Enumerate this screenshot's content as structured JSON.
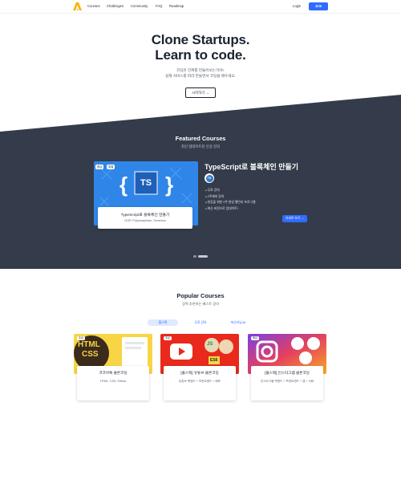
{
  "nav": {
    "links": [
      "Courses",
      "Challenges",
      "Community",
      "FAQ",
      "Roadmap"
    ],
    "login": "Login",
    "join": "Join"
  },
  "hero": {
    "title_line1": "Clone Startups.",
    "title_line2": "Learn to code.",
    "sub_line1": "코딩은 진짜를 만들어보는거야!.",
    "sub_line2": "실제 서비스를 따라 만들면서 코딩을 배우세요.",
    "cta": "시작하기 →"
  },
  "featured": {
    "title": "Featured Courses",
    "subtitle": "최신 업데이트된 신상 강의",
    "tags": [
      "중급",
      "특별"
    ],
    "card_title": "TypeScript로 블록체인 만들기",
    "card_sub": "OOP, Polymorphism, Generics",
    "heading": "TypeScript로 블록체인 만들기",
    "badge": "TS",
    "bullets": [
      "무료 강의",
      "2주제의 강의",
      "완강을 위한 2주 완성 챌린지 프로그램",
      "최신 버전으로 업데이트!"
    ],
    "detail_button": "자세히 보기 →",
    "icon_text": "TS"
  },
  "popular": {
    "title": "Popular Courses",
    "subtitle": "강력 추천하는 베스트 강의",
    "tabs": [
      "풀스택",
      "무료 강의",
      "머신러닝/AI"
    ],
    "courses": [
      {
        "tag": "초급",
        "title": "코코아톡 클론코딩",
        "sub": "HTML, CSS, Github",
        "img_text_1": "HTML",
        "img_text_2": "CSS"
      },
      {
        "tag": "초급",
        "title": "[풀스택] 유튜브 클론코딩",
        "sub": "유튜브 백엔드 + 프런트엔드 + 배포",
        "img_text_1": "ES6",
        "img_text_2": "JS"
      },
      {
        "tag": "중급",
        "title": "[풀스택] 인스타그램 클론코딩",
        "sub": "인스타그램 백엔드 + 프런트엔드 + 앱 + 서버"
      }
    ]
  }
}
